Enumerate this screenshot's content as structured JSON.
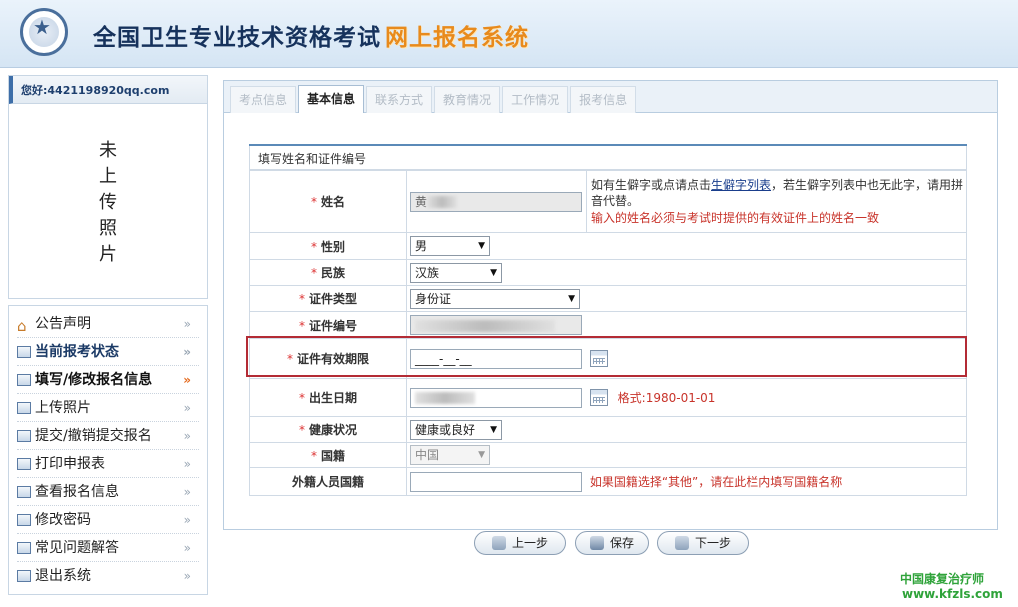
{
  "header": {
    "title_main": "全国卫生专业技术资格考试",
    "title_sub": "网上报名系统"
  },
  "user": {
    "greeting": "您好:4421198920qq.com",
    "photo_placeholder": "未上传照片"
  },
  "menu": [
    {
      "label": "公告声明",
      "icon": "house-icon"
    },
    {
      "label": "当前报考状态",
      "icon": "doc-icon"
    },
    {
      "label": "填写/修改报名信息",
      "icon": "doc-icon"
    },
    {
      "label": "上传照片",
      "icon": "doc-icon"
    },
    {
      "label": "提交/撤销提交报名",
      "icon": "doc-icon"
    },
    {
      "label": "打印申报表",
      "icon": "doc-icon"
    },
    {
      "label": "查看报名信息",
      "icon": "doc-icon"
    },
    {
      "label": "修改密码",
      "icon": "doc-icon"
    },
    {
      "label": "常见问题解答",
      "icon": "doc-icon"
    },
    {
      "label": "退出系统",
      "icon": "doc-icon"
    }
  ],
  "tabs": [
    "考点信息",
    "基本信息",
    "联系方式",
    "教育情况",
    "工作情况",
    "报考信息"
  ],
  "form": {
    "section_title": "填写姓名和证件编号",
    "name": {
      "label": "姓名",
      "value": "黄",
      "note_prefix": "如有生僻字或点请点击",
      "note_link": "生僻字列表",
      "note_suffix": "，若生僻字列表中也无此字，请用拼音代替。",
      "warning": "输入的姓名必须与考试时提供的有效证件上的姓名一致"
    },
    "gender": {
      "label": "性别",
      "value": "男"
    },
    "ethnicity": {
      "label": "民族",
      "value": "汉族"
    },
    "id_type": {
      "label": "证件类型",
      "value": "身份证"
    },
    "id_number": {
      "label": "证件编号",
      "value": ""
    },
    "id_expiry": {
      "label": "证件有效期限",
      "value": "____-__-__"
    },
    "birth_date": {
      "label": "出生日期",
      "format_hint": "格式:1980-01-01"
    },
    "health": {
      "label": "健康状况",
      "value": "健康或良好"
    },
    "nationality": {
      "label": "国籍",
      "value": "中国"
    },
    "foreign_nationality": {
      "label": "外籍人员国籍",
      "note": "如果国籍选择“其他”，请在此栏内填写国籍名称"
    }
  },
  "buttons": {
    "prev": "上一步",
    "save": "保存",
    "next": "下一步"
  },
  "watermark": {
    "line1": "中国康复治疗师",
    "line2": "www.kfzls.com"
  }
}
